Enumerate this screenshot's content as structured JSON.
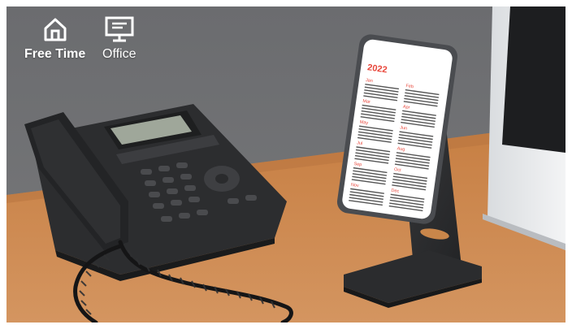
{
  "modes": [
    {
      "label": "Free Time",
      "icon": "home-icon"
    },
    {
      "label": "Office",
      "icon": "monitor-icon"
    }
  ],
  "phone_screen": {
    "year": "2022",
    "months": [
      "Jan",
      "Feb",
      "Mar",
      "Apr",
      "May",
      "Jun",
      "Jul",
      "Aug",
      "Sep",
      "Oct",
      "Nov",
      "Dec"
    ]
  },
  "colors": {
    "accent": "#e8463a",
    "wall": "#6d6e70",
    "desk": "#c9864a"
  }
}
